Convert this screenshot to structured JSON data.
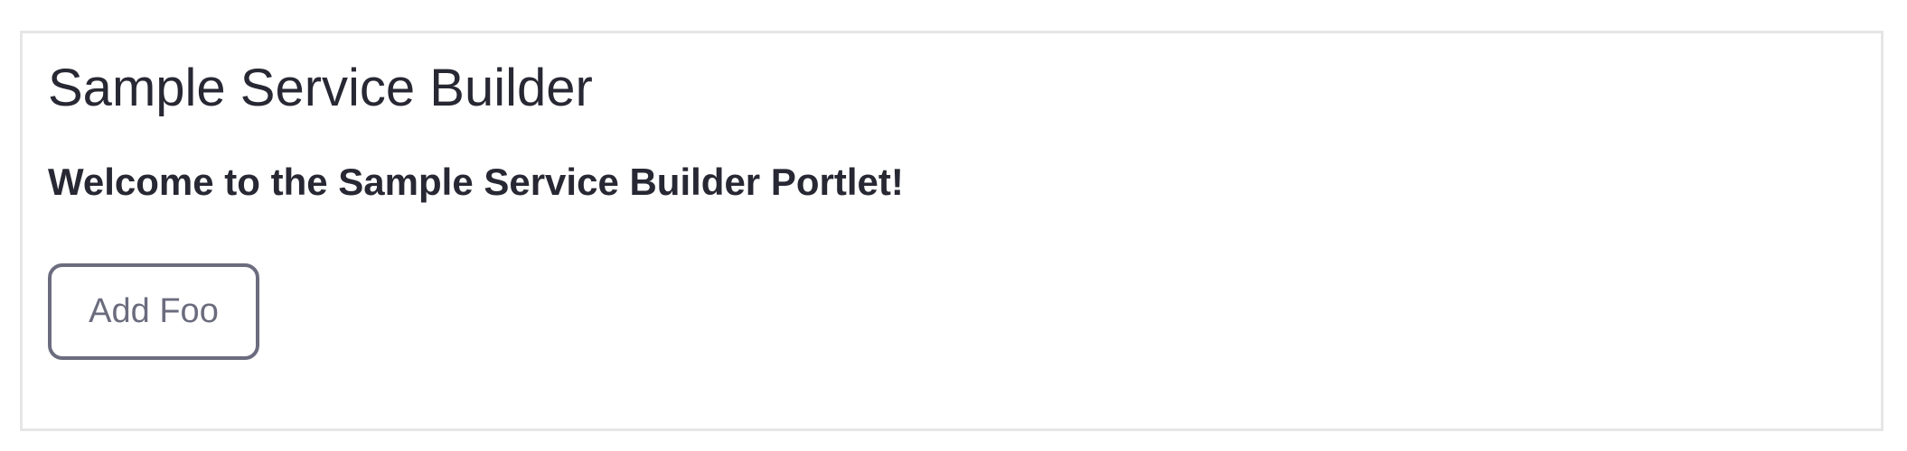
{
  "portlet": {
    "title": "Sample Service Builder",
    "welcome_message": "Welcome to the Sample Service Builder Portlet!",
    "add_button_label": "Add Foo"
  },
  "colors": {
    "text": "#272833",
    "button_border": "#6b6c7e",
    "panel_border": "#e6e6e8"
  }
}
